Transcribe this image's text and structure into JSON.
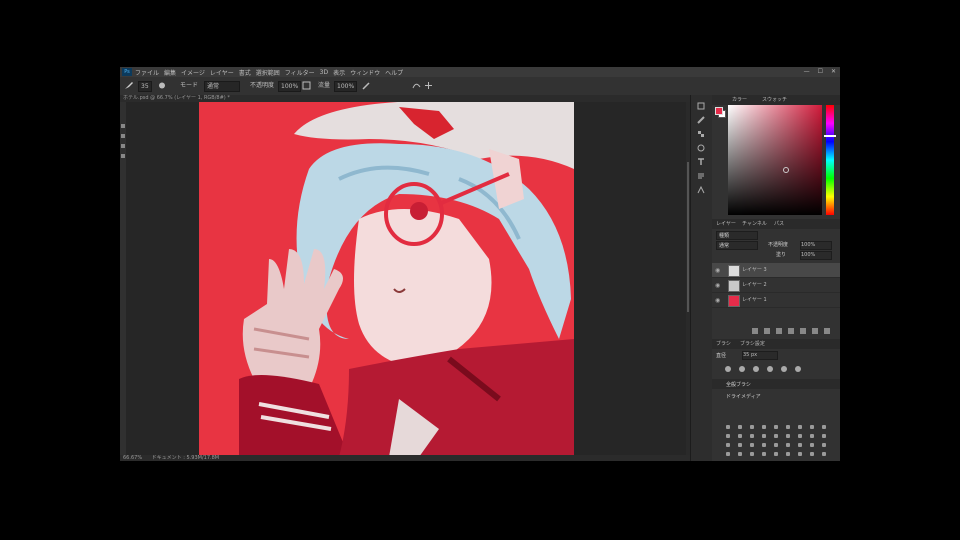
{
  "app": {
    "logo": "Ps",
    "menu": [
      "ファイル",
      "編集",
      "イメージ",
      "レイヤー",
      "書式",
      "選択範囲",
      "フィルター",
      "3D",
      "表示",
      "ウィンドウ",
      "ヘルプ"
    ],
    "window_controls": [
      "—",
      "☐",
      "✕"
    ]
  },
  "options_bar": {
    "brush_size": "35",
    "mode_label": "モード",
    "mode_value": "通常",
    "opacity_label": "不透明度",
    "opacity_value": "100%",
    "flow_label": "流量",
    "flow_value": "100%"
  },
  "document": {
    "tab_title": "ホテル.psd @ 66.7% (レイヤー 1, RGB/8#) *",
    "status_zoom": "66.67%",
    "status_info": "ドキュメント : 5.93M/17.8M"
  },
  "color_panel": {
    "tabs": [
      "カラー",
      "スウォッチ"
    ],
    "foreground_color": "#e52c4a",
    "background_color": "#ffffff",
    "base_hue_color": "#d11a3a"
  },
  "layers_panel": {
    "tabs": [
      "レイヤー",
      "チャンネル",
      "パス"
    ],
    "filter_label": "種類",
    "blend_mode": "通常",
    "opacity_label": "不透明度",
    "opacity": "100%",
    "fill_label": "塗り",
    "fill": "100%",
    "layers": [
      {
        "name": "レイヤー 3",
        "thumb": "#dcdcdc",
        "selected": true
      },
      {
        "name": "レイヤー 2",
        "thumb": "#c9c9c9",
        "selected": false
      },
      {
        "name": "レイヤー 1",
        "thumb": "#e52c4a",
        "selected": false
      }
    ]
  },
  "brush_panel": {
    "tabs": [
      "ブラシ",
      "ブラシ設定"
    ],
    "size_label": "直径",
    "size_value": "35 px",
    "group_name": "全般ブラシ",
    "group2_name": "ドライメディア"
  },
  "icons": {
    "toolbar": [
      "move-icon",
      "brush-icon",
      "eraser-icon",
      "eyedropper-icon"
    ],
    "dock": [
      "history-icon",
      "brush-settings-icon",
      "swatches-icon",
      "adjustments-icon",
      "type-icon",
      "paragraph-icon",
      "properties-icon"
    ]
  }
}
